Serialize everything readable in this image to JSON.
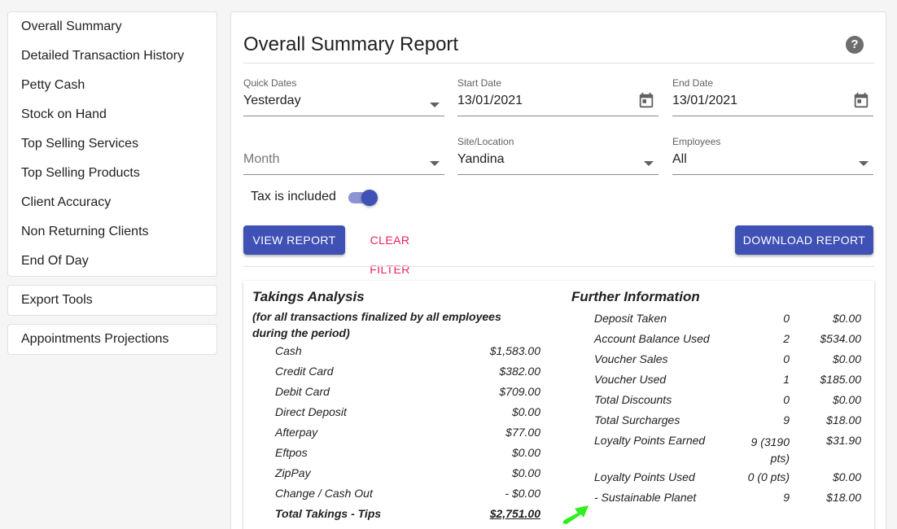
{
  "sidebar": {
    "items": [
      "Overall Summary",
      "Detailed Transaction History",
      "Petty Cash",
      "Stock on Hand",
      "Top Selling Services",
      "Top Selling Products",
      "Client Accuracy",
      "Non Returning Clients",
      "End Of Day"
    ],
    "export_tools": "Export Tools",
    "appointments_projections": "Appointments Projections"
  },
  "main": {
    "title": "Overall Summary Report",
    "help_icon": "?",
    "filters": {
      "quick_dates": {
        "label": "Quick Dates",
        "value": "Yesterday"
      },
      "start_date": {
        "label": "Start Date",
        "value": "13/01/2021"
      },
      "end_date": {
        "label": "End Date",
        "value": "13/01/2021"
      },
      "month": {
        "placeholder": "Month"
      },
      "site": {
        "label": "Site/Location",
        "value": "Yandina"
      },
      "employees": {
        "label": "Employees",
        "value": "All"
      }
    },
    "tax_toggle": {
      "label": "Tax is included",
      "on": true
    },
    "buttons": {
      "view_report": "VIEW REPORT",
      "clear_filter": "CLEAR FILTER",
      "download_report": "DOWNLOAD REPORT"
    },
    "colors": {
      "primary": "#3f51b5",
      "accent": "#e91e63"
    }
  },
  "takings": {
    "title": "Takings Analysis",
    "subtitle": "(for all transactions finalized by all employees during the period)",
    "rows": [
      {
        "name": "Cash",
        "amount": "$1,583.00"
      },
      {
        "name": "Credit Card",
        "amount": "$382.00"
      },
      {
        "name": "Debit Card",
        "amount": "$709.00"
      },
      {
        "name": "Direct Deposit",
        "amount": "$0.00"
      },
      {
        "name": "Afterpay",
        "amount": "$77.00"
      },
      {
        "name": "Eftpos",
        "amount": "$0.00"
      },
      {
        "name": "ZipPay",
        "amount": "$0.00"
      },
      {
        "name": "Change / Cash Out",
        "amount": "- $0.00"
      }
    ],
    "total": {
      "name": "Total Takings - Tips",
      "amount": "$2,751.00"
    }
  },
  "further": {
    "title": "Further Information",
    "rows": [
      {
        "name": "Deposit Taken",
        "count": "0",
        "amount": "$0.00"
      },
      {
        "name": "Account Balance Used",
        "count": "2",
        "amount": "$534.00"
      },
      {
        "name": "Voucher Sales",
        "count": "0",
        "amount": "$0.00"
      },
      {
        "name": "Voucher Used",
        "count": "1",
        "amount": "$185.00"
      },
      {
        "name": "Total Discounts",
        "count": "0",
        "amount": "$0.00"
      },
      {
        "name": "Total Surcharges",
        "count": "9",
        "amount": "$18.00"
      },
      {
        "name": "Loyalty Points Earned",
        "count": "9 (3190 pts)",
        "amount": "$31.90"
      },
      {
        "name": "Loyalty Points Used",
        "count": "0 (0 pts)",
        "amount": "$0.00"
      },
      {
        "name": "- Sustainable Planet",
        "count": "9",
        "amount": "$18.00"
      }
    ]
  }
}
